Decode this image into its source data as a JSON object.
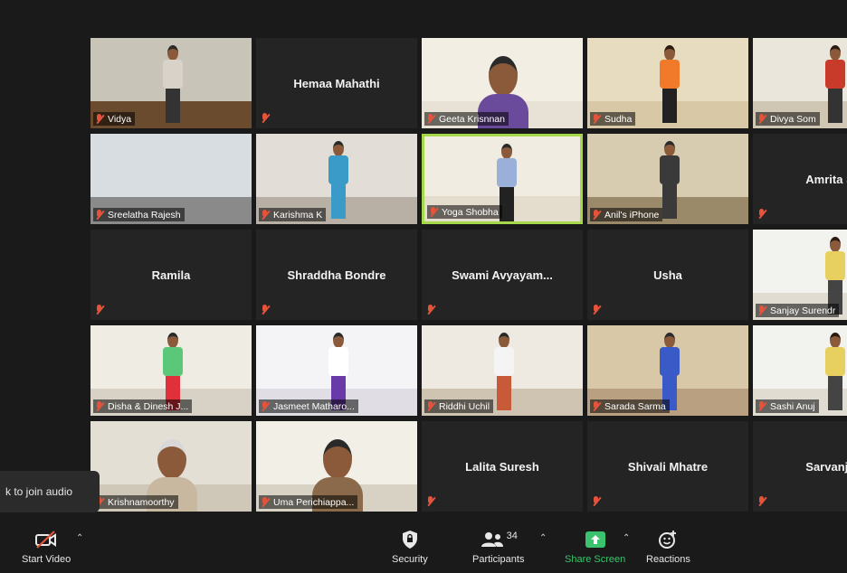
{
  "tiles": [
    {
      "row": 0,
      "col": 0,
      "name": "Vidya",
      "video": true,
      "scene": "room-dark"
    },
    {
      "row": 0,
      "col": 1,
      "name": "Hemaa Mahathi",
      "video": false
    },
    {
      "row": 0,
      "col": 2,
      "name": "Geeta Krisnnan",
      "video": true,
      "scene": "face"
    },
    {
      "row": 0,
      "col": 3,
      "name": "Sudha",
      "video": true,
      "scene": "orange"
    },
    {
      "row": 0,
      "col": 4,
      "name": "Divya Som",
      "video": true,
      "scene": "red"
    },
    {
      "row": 1,
      "col": 0,
      "name": "Sreelatha Rajesh",
      "video": true,
      "scene": "living"
    },
    {
      "row": 1,
      "col": 1,
      "name": "Karishma K",
      "video": true,
      "scene": "ceiling"
    },
    {
      "row": 1,
      "col": 2,
      "name": "Yoga Shobha",
      "video": true,
      "scene": "studio",
      "active": true
    },
    {
      "row": 1,
      "col": 3,
      "name": "Anil's iPhone",
      "video": true,
      "scene": "two"
    },
    {
      "row": 1,
      "col": 4,
      "name": "Amrita Su",
      "video": false
    },
    {
      "row": 2,
      "col": 0,
      "name": "Ramila",
      "video": false
    },
    {
      "row": 2,
      "col": 1,
      "name": "Shraddha Bondre",
      "video": false
    },
    {
      "row": 2,
      "col": 2,
      "name": "Swami  Avyayam...",
      "video": false
    },
    {
      "row": 2,
      "col": 3,
      "name": "Usha",
      "video": false
    },
    {
      "row": 2,
      "col": 4,
      "name": "Sanjay Surendr",
      "video": true,
      "scene": "bright"
    },
    {
      "row": 3,
      "col": 0,
      "name": "Disha & Dinesh J...",
      "video": true,
      "scene": "green"
    },
    {
      "row": 3,
      "col": 1,
      "name": "Jasmeet Matharo...",
      "video": true,
      "scene": "purple"
    },
    {
      "row": 3,
      "col": 2,
      "name": "Riddhi Uchil",
      "video": true,
      "scene": "white"
    },
    {
      "row": 3,
      "col": 3,
      "name": "Sarada Sarma",
      "video": true,
      "scene": "blue"
    },
    {
      "row": 3,
      "col": 4,
      "name": "Sashi Anuj",
      "video": true,
      "scene": "bright"
    },
    {
      "row": 4,
      "col": 0,
      "name": "Krishnamoorthy",
      "video": true,
      "scene": "old"
    },
    {
      "row": 4,
      "col": 1,
      "name": "Uma Perichiappa...",
      "video": true,
      "scene": "face2"
    },
    {
      "row": 4,
      "col": 2,
      "name": "Lalita Suresh",
      "video": false
    },
    {
      "row": 4,
      "col": 3,
      "name": "Shivali Mhatre",
      "video": false
    },
    {
      "row": 4,
      "col": 4,
      "name": "Sarvanjay",
      "video": false
    }
  ],
  "audio_tip": "k to join audio",
  "toolbar": {
    "start_video": "Start Video",
    "security": "Security",
    "participants": "Participants",
    "participants_count": "34",
    "share_screen": "Share Screen",
    "reactions": "Reactions"
  },
  "colors": {
    "background": "#1a1a1a",
    "tile": "#242424",
    "active_border": "#a5d94a",
    "share_green": "#3ac26e",
    "mute_red": "#e5533b"
  }
}
